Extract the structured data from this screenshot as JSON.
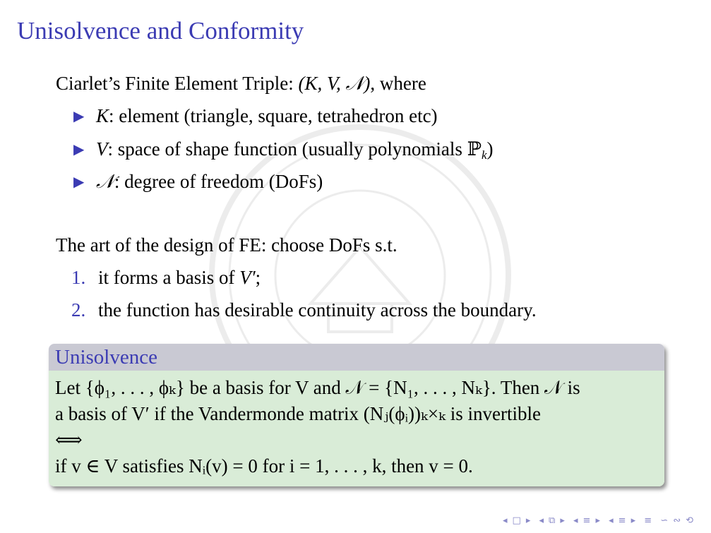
{
  "slide": {
    "title": "Unisolvence and Conformity"
  },
  "triple": {
    "intro": "Ciarlet’s Finite Element Triple:",
    "tuple": "(K, V, 𝒩)",
    "where": ", where",
    "items": [
      {
        "symbol": "K",
        "text": ": element (triangle, square, tetrahedron etc)"
      },
      {
        "symbol": "V",
        "text": ": space of shape function (usually polynomials ℙ",
        "sub": "k",
        "tail": ")"
      },
      {
        "symbol": "𝒩",
        "text": ": degree of freedom (DoFs)"
      }
    ]
  },
  "design": {
    "intro": "The art of the design of FE: choose DoFs s.t.",
    "items": [
      {
        "num": "1.",
        "text_pre": "it forms a basis of ",
        "math": "V′",
        "text_post": ";"
      },
      {
        "num": "2.",
        "text_pre": "the function has desirable continuity across the boundary.",
        "math": "",
        "text_post": ""
      }
    ]
  },
  "unisolvence": {
    "heading": "Unisolvence",
    "line1": "Let {ϕ₁, . . . , ϕₖ} be a basis for V and 𝒩 = {N₁, . . . , Nₖ}. Then 𝒩 is",
    "line2": "a basis of V′ if the Vandermonde matrix (Nⱼ(ϕᵢ))ₖ×ₖ is invertible",
    "line3": "⟺",
    "line4": "if v ∈ V satisfies Nᵢ(v) = 0 for i = 1, . . . , k, then v = 0."
  },
  "nav": {
    "symbols": [
      "◂",
      "□",
      "▸",
      "◂",
      "⧉",
      "▸",
      "◂",
      "≡",
      "▸",
      "◂",
      "≡",
      "▸",
      "≡",
      "∽",
      "∾",
      "⟲"
    ]
  },
  "colors": {
    "accent": "#3b3bb3",
    "block_head": "#c9c9d3",
    "block_body": "#d9ecd7"
  }
}
